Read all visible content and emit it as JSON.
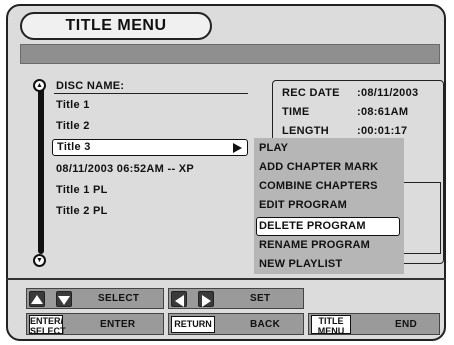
{
  "title": "TITLE MENU",
  "list": {
    "header": "DISC NAME:",
    "items": [
      "Title 1",
      "Title 2",
      "Title 3",
      "08/11/2003 06:52AM -- XP",
      "Title 1 PL",
      "Title 2 PL"
    ],
    "selected_index": 2
  },
  "info": {
    "rec_date_label": "REC DATE",
    "rec_date_value": ":08/11/2003",
    "time_label": "TIME",
    "time_value": ":08:61AM",
    "length_label": "LENGTH",
    "length_value": ":00:01:17"
  },
  "popup_menu": {
    "items": [
      "PLAY",
      "ADD CHAPTER MARK",
      "COMBINE CHAPTERS",
      "EDIT PROGRAM",
      "DELETE PROGRAM",
      "RENAME PROGRAM",
      "NEW PLAYLIST"
    ],
    "highlighted_index": 4
  },
  "footer": {
    "select_label": "SELECT",
    "set_label": "SET",
    "enter_key": "ENTER/ SELECT",
    "enter_label": "ENTER",
    "return_key": "RETURN",
    "back_label": "BACK",
    "title_menu_key": "TITLE MENU",
    "end_label": "END"
  },
  "icons": {
    "scroll_up": "scroll-up-icon",
    "scroll_down": "scroll-down-icon",
    "up_arrow": "up-arrow-icon",
    "down_arrow": "down-arrow-icon",
    "left_arrow": "left-arrow-icon",
    "right_arrow": "right-arrow-icon"
  }
}
